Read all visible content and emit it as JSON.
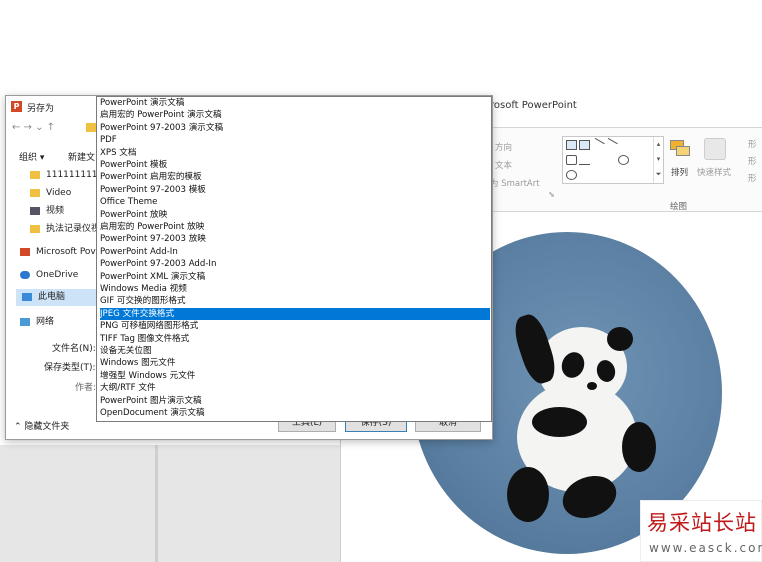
{
  "powerpoint": {
    "title_partial": "rosoft PowerPoint",
    "ribbon": {
      "direction": "方向",
      "text": "文本",
      "smartart": "为 SmartArt",
      "arrange": "排列",
      "quick_styles": "快速样式",
      "group_drawing": "绘图",
      "right_1": "形",
      "right_2": "形",
      "right_3": "形"
    }
  },
  "dialog": {
    "title": "另存为",
    "logo_letter": "P",
    "nav": "←  →  ⌄  ↑",
    "organize": "组织 ▾",
    "new_folder": "新建文",
    "sidebar": [
      {
        "label": "111111111",
        "icon": "folder-icon"
      },
      {
        "label": "Video",
        "icon": "folder-icon"
      },
      {
        "label": "视频",
        "icon": "video-icon"
      },
      {
        "label": "执法记录仪视",
        "icon": "folder-icon"
      },
      {
        "label": "Microsoft Pov",
        "icon": "powerpoint-icon"
      },
      {
        "label": "OneDrive",
        "icon": "cloud-icon"
      },
      {
        "label": "此电脑",
        "icon": "computer-icon"
      },
      {
        "label": "网络",
        "icon": "network-icon"
      }
    ],
    "filename_label": "文件名(N):",
    "savetype_label": "保存类型(T):",
    "author_label": "作者:",
    "hide_folders": "隐藏文件夹",
    "tools_btn": "工具(L)",
    "save_btn": "保存(S)",
    "cancel_btn": "取消"
  },
  "dropdown": {
    "options": [
      "PowerPoint 演示文稿",
      "启用宏的 PowerPoint 演示文稿",
      "PowerPoint 97-2003 演示文稿",
      "PDF",
      "XPS 文档",
      "PowerPoint 模板",
      "PowerPoint 启用宏的模板",
      "PowerPoint 97-2003 模板",
      "Office Theme",
      "PowerPoint 放映",
      "启用宏的 PowerPoint 放映",
      "PowerPoint 97-2003 放映",
      "PowerPoint Add-In",
      "PowerPoint 97-2003 Add-In",
      "PowerPoint XML 演示文稿",
      "Windows Media 视频",
      "GIF 可交换的图形格式",
      "JPEG 文件交换格式",
      "PNG 可移植网络图形格式",
      "TIFF Tag 图像文件格式",
      "设备无关位图",
      "Windows 图元文件",
      "增强型 Windows 元文件",
      "大纲/RTF 文件",
      "PowerPoint 图片演示文稿",
      "OpenDocument 演示文稿"
    ],
    "selected_index": 17
  },
  "watermark": {
    "cn": "易采站长站",
    "url": "www.easck.com"
  }
}
